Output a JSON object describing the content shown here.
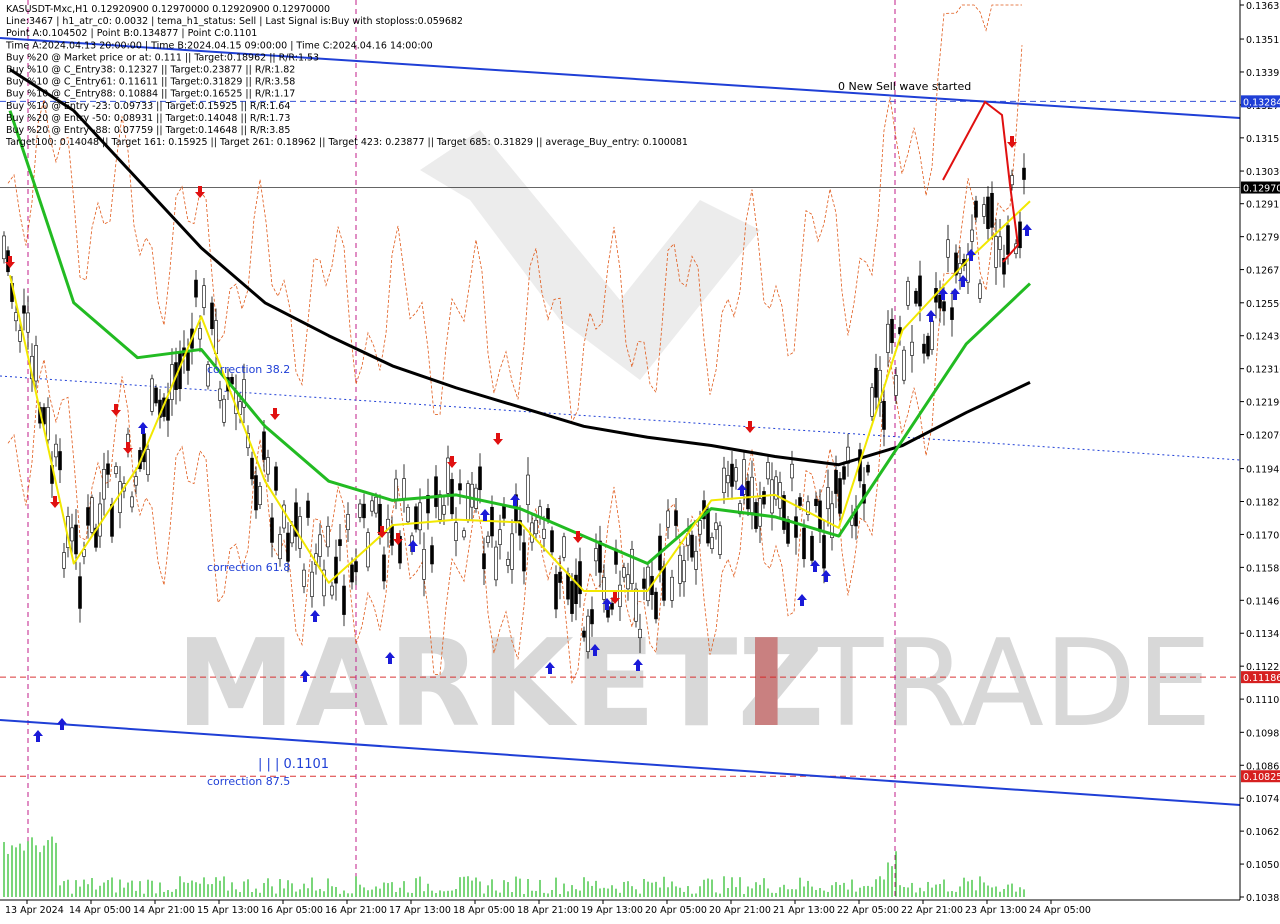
{
  "header": {
    "lines": [
      "KASUSDT-Mxc,H1  0.12920900 0.12970000 0.12920900 0.12970000",
      "Line:3467 | h1_atr_c0: 0.0032 | tema_h1_status: Sell | Last Signal is:Buy with stoploss:0.059682",
      "Point A:0.104502 | Point B:0.134877 | Point C:0.1101",
      "Time A:2024.04.13 20:00:00 | Time B:2024.04.15 09:00:00 | Time C:2024.04.16 14:00:00",
      "Buy %20 @ Market price or at: 0.111 || Target:0.18962 || R/R:1.53",
      "Buy %10 @ C_Entry38: 0.12327 || Target:0.23877 || R/R:1.82",
      "Buy %10 @ C_Entry61: 0.11611 || Target:0.31829 || R/R:3.58",
      "Buy %10 @ C_Entry88: 0.10884 || Target:0.16525 || R/R:1.17",
      "Buy %10 @ Entry -23: 0.09733 || Target:0.15925 || R/R:1.64",
      "Buy %20 @ Entry -50: 0.08931 || Target:0.14048 || R/R:1.73",
      "Buy %20 @ Entry -88: 0.07759 || Target:0.14648 || R/R:3.85",
      "Target100: 0.14048 || Target 161: 0.15925 || Target 261: 0.18962 || Target 423: 0.23877 || Target 685: 0.31829 || average_Buy_entry: 0.100081"
    ]
  },
  "annotations": {
    "sell_wave": "0 New Sell wave started",
    "corr382": "correction 38.2",
    "corr618": "correction 61.8",
    "corr875": "correction 87.5",
    "point_c": "| | | 0.1101"
  },
  "watermark": {
    "part1": "MARKETZ",
    "part2": "I",
    "part3": "TRADE"
  },
  "price_axis": {
    "ticks": [
      "0.13635",
      "0.13511",
      "0.13391",
      "0.13271",
      "0.13151",
      "0.13030",
      "0.12911",
      "0.12791",
      "0.12671",
      "0.12550",
      "0.12430",
      "0.12310",
      "0.12190",
      "0.12070",
      "0.11946",
      "0.11826",
      "0.11706",
      "0.11586",
      "0.11466",
      "0.11346",
      "0.11226",
      "0.11106",
      "0.10985",
      "0.10865",
      "0.10745",
      "0.10625",
      "0.10505",
      "0.10385"
    ],
    "badges": [
      {
        "label": "0.13284",
        "value": 0.13284,
        "color": "#1f3fd6"
      },
      {
        "label": "0.12970",
        "value": 0.1297,
        "color": "#000000"
      },
      {
        "label": "0.11186",
        "value": 0.11186,
        "color": "#d62020"
      },
      {
        "label": "0.10825",
        "value": 0.10825,
        "color": "#d62020"
      }
    ]
  },
  "time_axis": {
    "labels": [
      "13 Apr 2024",
      "14 Apr 05:00",
      "14 Apr 21:00",
      "15 Apr 13:00",
      "16 Apr 05:00",
      "16 Apr 21:00",
      "17 Apr 13:00",
      "18 Apr 05:00",
      "18 Apr 21:00",
      "19 Apr 13:00",
      "20 Apr 05:00",
      "20 Apr 21:00",
      "21 Apr 13:00",
      "22 Apr 05:00",
      "22 Apr 21:00",
      "23 Apr 13:00",
      "24 Apr 05:00"
    ]
  },
  "chart_data": {
    "type": "line",
    "title": "KASUSDT-Mxc,H1",
    "ylim": [
      0.10385,
      0.13635
    ],
    "x": [
      "13 Apr 2024",
      "14 Apr 05:00",
      "14 Apr 21:00",
      "15 Apr 13:00",
      "16 Apr 05:00",
      "16 Apr 21:00",
      "17 Apr 13:00",
      "18 Apr 05:00",
      "18 Apr 21:00",
      "19 Apr 13:00",
      "20 Apr 05:00",
      "20 Apr 21:00",
      "21 Apr 13:00",
      "22 Apr 05:00",
      "22 Apr 21:00",
      "23 Apr 13:00",
      "24 Apr 05:00"
    ],
    "series": [
      {
        "name": "",
        "color": "#000000",
        "values": [
          0.134,
          0.1325,
          0.13,
          0.1275,
          0.1255,
          0.1243,
          0.1232,
          0.1224,
          0.1217,
          0.121,
          0.1206,
          0.1203,
          0.1199,
          0.1196,
          0.1203,
          0.1215,
          0.1226
        ]
      },
      {
        "name": "",
        "color": "#22bb22",
        "values": [
          0.1325,
          0.1255,
          0.1235,
          0.1238,
          0.121,
          0.119,
          0.1183,
          0.1185,
          0.118,
          0.117,
          0.116,
          0.118,
          0.1177,
          0.117,
          0.1205,
          0.124,
          0.1262
        ]
      },
      {
        "name": "",
        "color": "#f2e800",
        "values": [
          0.1265,
          0.116,
          0.1195,
          0.125,
          0.119,
          0.1153,
          0.1174,
          0.1176,
          0.1175,
          0.115,
          0.115,
          0.1183,
          0.1185,
          0.1173,
          0.1245,
          0.127,
          0.1292
        ]
      }
    ],
    "horizontal_levels": [
      0.13284,
      0.1297,
      0.11186,
      0.10825
    ]
  }
}
